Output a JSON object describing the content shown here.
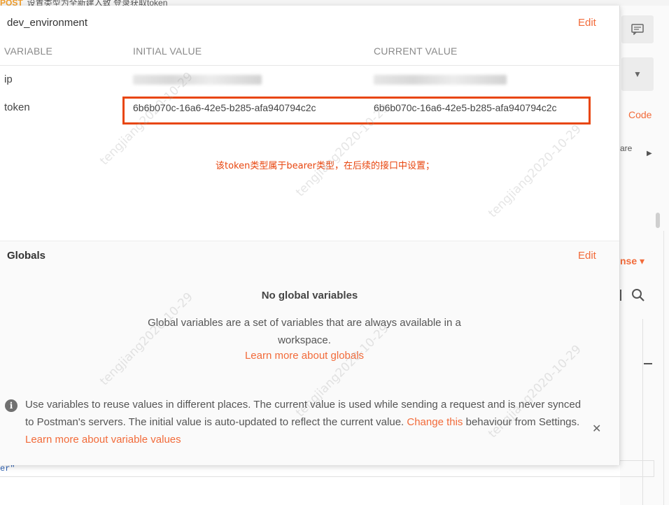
{
  "background": {
    "tab_method": "POST",
    "tab_fragment": "设置类型为全新建入致    登录获取token",
    "code_link": "Code",
    "are_text": "are",
    "response_label": "nse ▾",
    "bottom_fragment": "er\""
  },
  "environment": {
    "name": "dev_environment",
    "edit_label": "Edit",
    "columns": [
      "VARIABLE",
      "INITIAL VALUE",
      "CURRENT VALUE"
    ],
    "rows": [
      {
        "name": "ip",
        "initial": "",
        "current": ""
      },
      {
        "name": "token",
        "initial": "6b6b070c-16a6-42e5-b285-afa940794c2c",
        "current": "6b6b070c-16a6-42e5-b285-afa940794c2c"
      }
    ],
    "annotation": "该token类型属于bearer类型，在后续的接口中设置；"
  },
  "globals": {
    "title": "Globals",
    "edit_label": "Edit",
    "empty_title": "No global variables",
    "empty_desc": "Global variables are a set of variables that are always available in a workspace.",
    "learn_link": "Learn more about globals"
  },
  "info": {
    "text1": "Use variables to reuse values in different places. The current value is used while sending a request and is never synced to Postman's servers. The initial value is auto-updated to reflect the current value. ",
    "change_link": "Change this",
    "text2": " behaviour from Settings. ",
    "learn_link": "Learn more about variable values"
  },
  "watermark": "tengjiang2020-10-29",
  "colors": {
    "accent": "#f26b3a",
    "highlight": "#e8460f"
  }
}
